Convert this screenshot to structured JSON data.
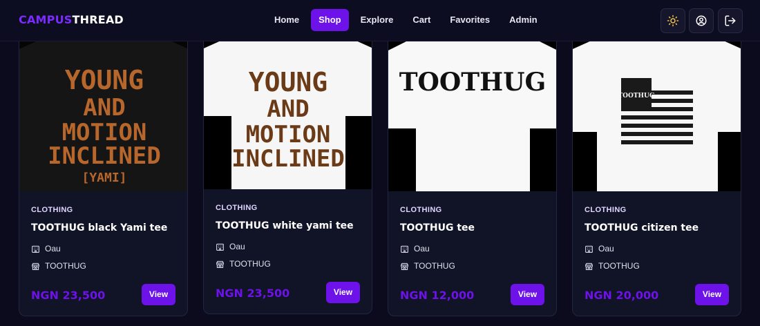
{
  "brand": {
    "part1": "CAMPUS",
    "part2": "THREAD",
    "accent": "#6d12e8"
  },
  "nav": [
    {
      "label": "Home",
      "active": false
    },
    {
      "label": "Shop",
      "active": true
    },
    {
      "label": "Explore",
      "active": false
    },
    {
      "label": "Cart",
      "active": false
    },
    {
      "label": "Favorites",
      "active": false
    },
    {
      "label": "Admin",
      "active": false
    }
  ],
  "header_icons": [
    "sun-icon",
    "user-circle-icon",
    "logout-icon"
  ],
  "products": [
    {
      "category": "CLOTHING",
      "title": "TOOTHUG black Yami tee",
      "school": "Oau",
      "store": "TOOTHUG",
      "price": "NGN 23,500",
      "button": "View",
      "image": {
        "shirt_color": "black",
        "print_lines": [
          "YOUNG",
          "AND",
          "MOTION",
          "INCLINED"
        ],
        "sub_print": "[YAMI]"
      }
    },
    {
      "category": "CLOTHING",
      "title": "TOOTHUG white yami tee",
      "school": "Oau",
      "store": "TOOTHUG",
      "price": "NGN 23,500",
      "button": "View",
      "image": {
        "shirt_color": "white",
        "print_lines": [
          "YOUNG",
          "AND",
          "MOTION",
          "INCLINED"
        ]
      }
    },
    {
      "category": "CLOTHING",
      "title": "TOOTHUG tee",
      "school": "Oau",
      "store": "TOOTHUG",
      "price": "NGN 12,000",
      "button": "View",
      "image": {
        "shirt_color": "white",
        "print_lines": [
          "TOOTHUG"
        ]
      }
    },
    {
      "category": "CLOTHING",
      "title": "TOOTHUG citizen tee",
      "school": "Oau",
      "store": "TOOTHUG",
      "price": "NGN 20,000",
      "button": "View",
      "image": {
        "shirt_color": "white",
        "print_lines": [
          "TOOTHUG"
        ]
      }
    }
  ]
}
